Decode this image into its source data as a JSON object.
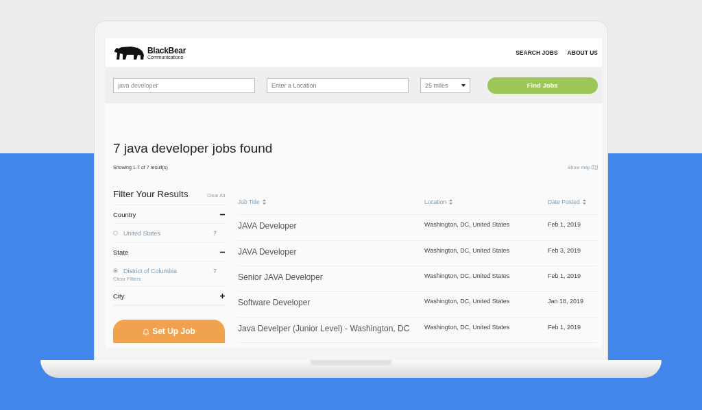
{
  "brand": {
    "name": "BlackBear",
    "tagline": "Communications"
  },
  "nav": [
    {
      "label": "SEARCH JOBS"
    },
    {
      "label": "ABOUT US"
    }
  ],
  "search": {
    "keyword": "java developer",
    "location_placeholder": "Enter a Location",
    "radius": "25 miles",
    "button": "Find Jobs"
  },
  "results": {
    "heading": "7 java developer jobs found",
    "summary": "Showing 1-7 of 7 result(s)",
    "map_link": "Show map"
  },
  "filters": {
    "title": "Filter Your Results",
    "clear_all": "Clear All",
    "groups": [
      {
        "name": "Country",
        "expanded": true,
        "options": [
          {
            "label": "United States",
            "count": "7",
            "selected": false
          }
        ]
      },
      {
        "name": "State",
        "expanded": true,
        "options": [
          {
            "label": "District of Columbia",
            "count": "7",
            "selected": true
          }
        ],
        "clear": "Clear Filters"
      },
      {
        "name": "City",
        "expanded": false
      }
    ],
    "alert_button": "Set Up Job"
  },
  "table": {
    "columns": [
      "Job Title",
      "Location",
      "Date Posted"
    ],
    "rows": [
      {
        "title": "JAVA Developer",
        "location": "Washington, DC, United States",
        "date": "Feb 1, 2019"
      },
      {
        "title": "JAVA Developer",
        "location": "Washington, DC, United States",
        "date": "Feb 3, 2019"
      },
      {
        "title": "Senior JAVA Developer",
        "location": "Washington, DC, United States",
        "date": "Feb 1, 2019"
      },
      {
        "title": "Software Developer",
        "location": "Washington, DC, United States",
        "date": "Jan 18, 2019"
      },
      {
        "title": "Java Develper (Junior Level) - Washington, DC",
        "location": "Washington, DC, United States",
        "date": "Feb 1, 2019"
      }
    ]
  }
}
